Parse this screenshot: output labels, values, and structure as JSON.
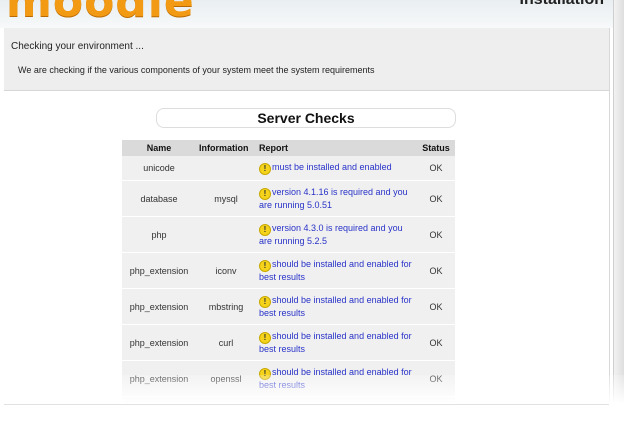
{
  "header": {
    "logo": "moodle",
    "title": "Installation"
  },
  "environment": {
    "checking": "Checking your environment ...",
    "description": "We are checking if the various components of your system meet the system requirements"
  },
  "server_checks": {
    "title": "Server Checks",
    "columns": [
      "Name",
      "Information",
      "Report",
      "Status"
    ],
    "rows": [
      {
        "name": "unicode",
        "info": "",
        "report": "must be installed and enabled",
        "status": "OK"
      },
      {
        "name": "database",
        "info": "mysql",
        "report": "version 4.1.16 is required and you are running 5.0.51",
        "status": "OK"
      },
      {
        "name": "php",
        "info": "",
        "report": "version 4.3.0 is required and you are running 5.2.5",
        "status": "OK"
      },
      {
        "name": "php_extension",
        "info": "iconv",
        "report": "should be installed and enabled for best results",
        "status": "OK"
      },
      {
        "name": "php_extension",
        "info": "mbstring",
        "report": "should be installed and enabled for best results",
        "status": "OK"
      },
      {
        "name": "php_extension",
        "info": "curl",
        "report": "should be installed and enabled for best results",
        "status": "OK"
      },
      {
        "name": "php_extension",
        "info": "openssl",
        "report": "should be installed and enabled for best results",
        "status": "OK"
      }
    ]
  },
  "icons": {
    "report": "warning-icon"
  },
  "colors": {
    "logo": "#f39a15",
    "link": "#2832c8",
    "header_row": "#dadada"
  }
}
